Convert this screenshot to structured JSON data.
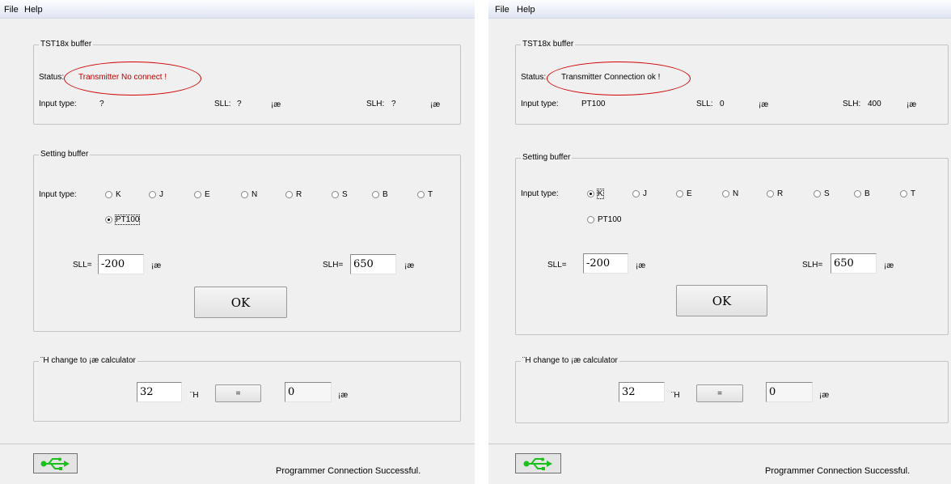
{
  "menu": {
    "file": "File",
    "help": "Help"
  },
  "windows": {
    "left": {
      "tst": {
        "title": "TST18x buffer",
        "status_label": "Status:",
        "status_value": "Transmitter No connect !",
        "input_type_label": "Input type:",
        "input_type_value": "?",
        "sll_label": "SLL:",
        "sll_value": "?",
        "slh_label": "SLH:",
        "slh_value": "?",
        "unit": "¡æ"
      },
      "setting": {
        "title": "Setting buffer",
        "input_type_label": "Input type:",
        "radios": [
          "K",
          "J",
          "E",
          "N",
          "R",
          "S",
          "B",
          "T",
          "PT100"
        ],
        "selected": "PT100",
        "sll_label": "SLL=",
        "sll_value": "-200",
        "slh_label": "SLH=",
        "slh_value": "650",
        "unit": "¡æ",
        "ok_label": "OK"
      },
      "calc": {
        "title": "¨H change to ¡æ calculator",
        "input_value": "32",
        "input_unit": "¨H",
        "eq_label": "=",
        "output_value": "0",
        "output_unit": "¡æ"
      },
      "footer": {
        "message": "Programmer Connection Successful."
      }
    },
    "right": {
      "tst": {
        "title": "TST18x buffer",
        "status_label": "Status:",
        "status_value": "Transmitter Connection ok !",
        "input_type_label": "Input type:",
        "input_type_value": "PT100",
        "sll_label": "SLL:",
        "sll_value": "0",
        "slh_label": "SLH:",
        "slh_value": "400",
        "unit": "¡æ"
      },
      "setting": {
        "title": "Setting buffer",
        "input_type_label": "Input type:",
        "radios": [
          "K",
          "J",
          "E",
          "N",
          "R",
          "S",
          "B",
          "T",
          "PT100"
        ],
        "selected": "K",
        "sll_label": "SLL=",
        "sll_value": "-200",
        "slh_label": "SLH=",
        "slh_value": "650",
        "unit": "¡æ",
        "ok_label": "OK"
      },
      "calc": {
        "title": "¨H change to ¡æ calculator",
        "input_value": "32",
        "input_unit": "¨H",
        "eq_label": "=",
        "output_value": "0",
        "output_unit": "¡æ"
      },
      "footer": {
        "message": "Programmer Connection Successful."
      }
    }
  },
  "colors": {
    "status_text": "#c00000",
    "annotation_ellipse": "#d00000",
    "usb_icon": "#1cc01c"
  },
  "icons": {
    "usb": "usb-icon"
  }
}
